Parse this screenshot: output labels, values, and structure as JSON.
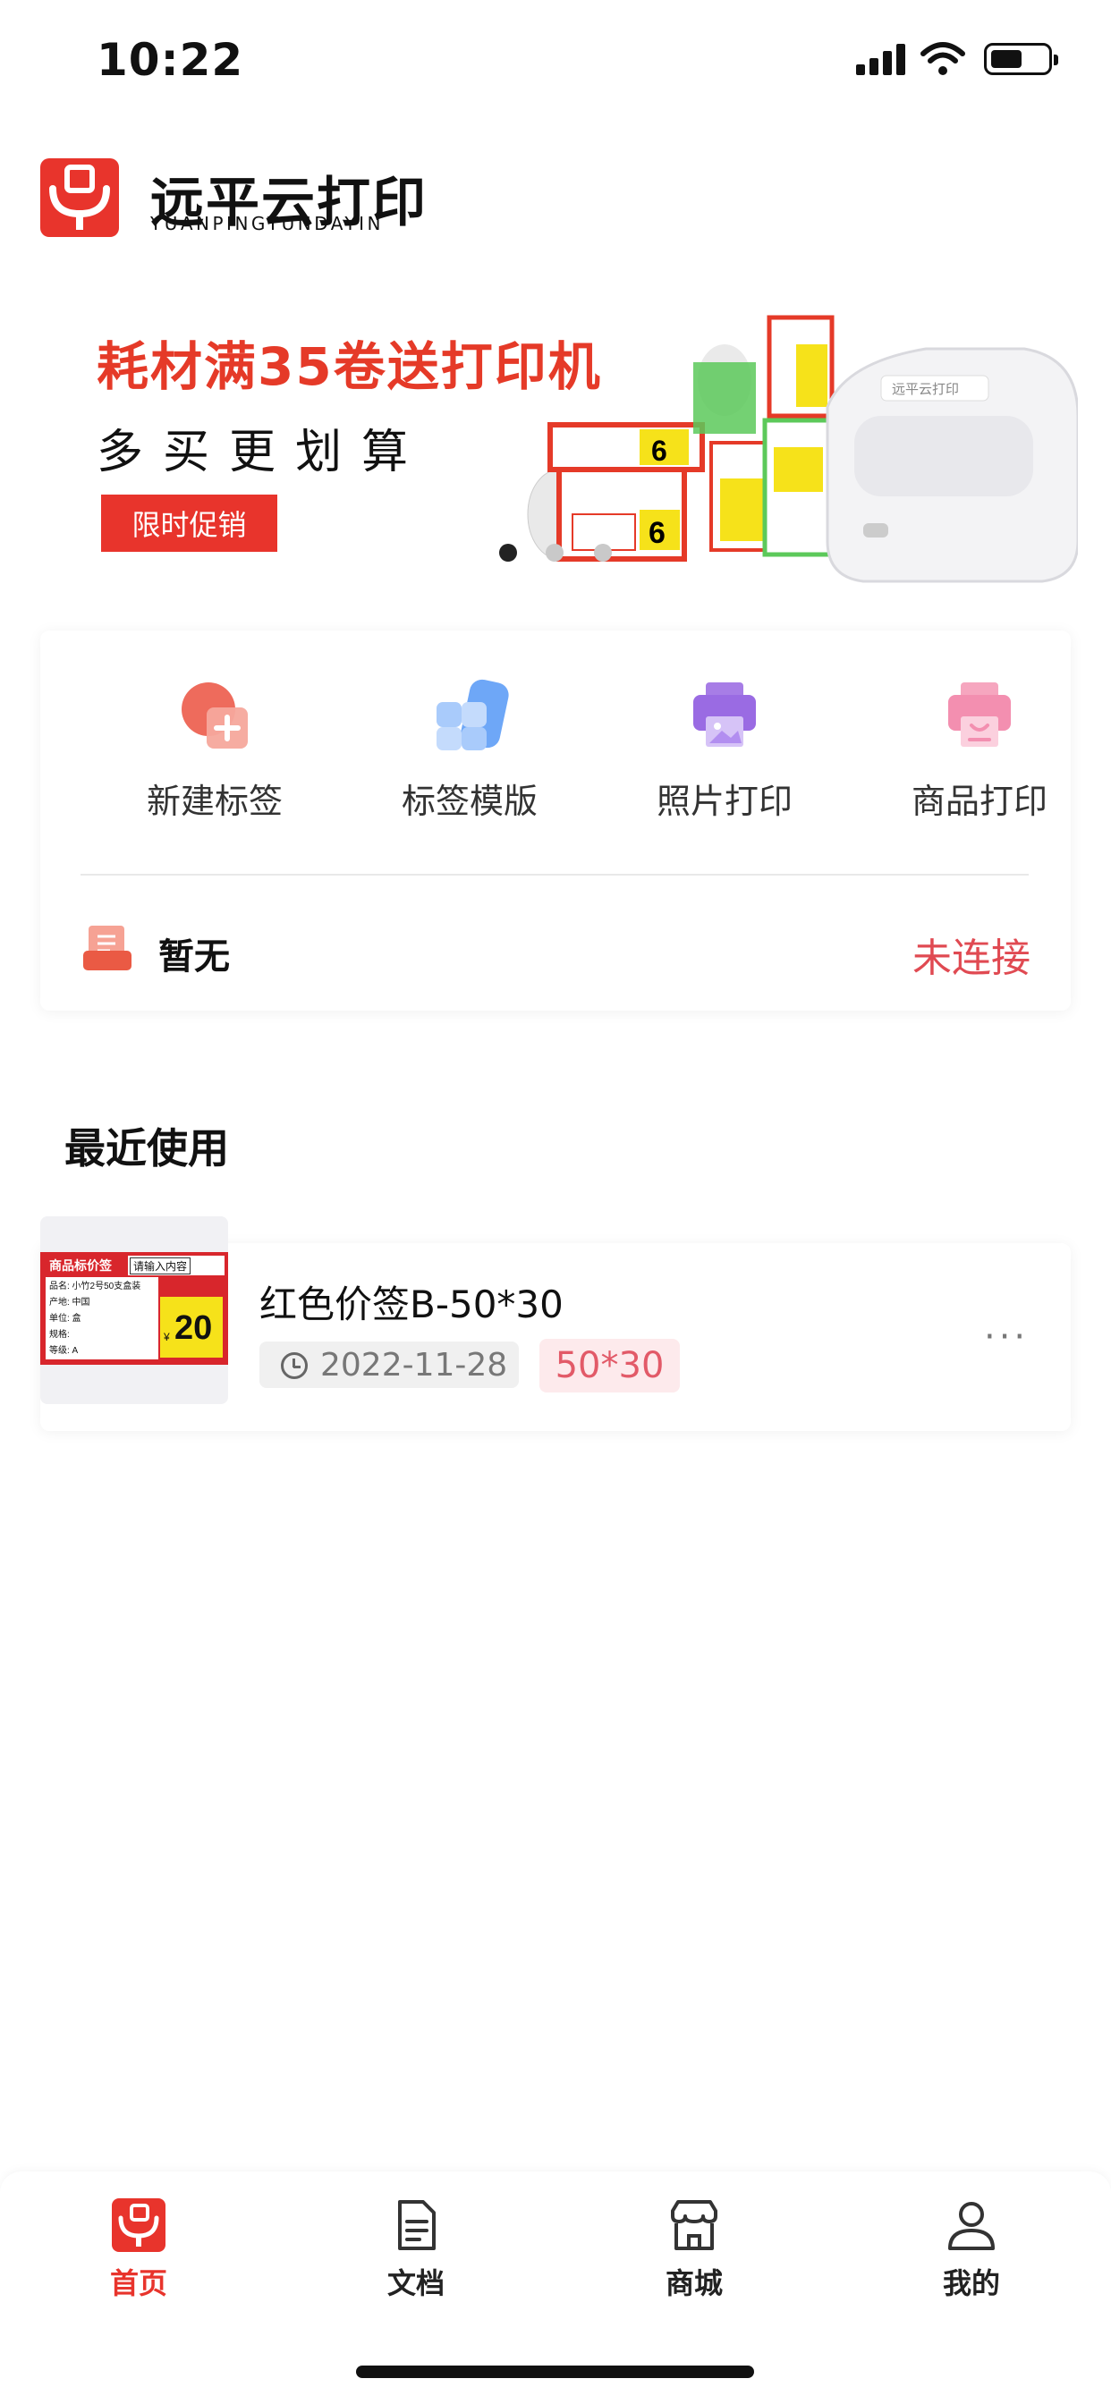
{
  "status_bar": {
    "time": "10:22"
  },
  "logo": {
    "name_cn": "远平云打印",
    "name_en": "YUANPINGYUNDAYIN"
  },
  "banner": {
    "title": "耗材满35卷送打印机",
    "subtitle": "多买更划算",
    "button_label": "限时促销",
    "printer_label_text": "远平云打印",
    "label_price_1": "6",
    "label_price_2": "6",
    "carousel": {
      "count": 3,
      "active_index": 0
    }
  },
  "quick_actions": [
    {
      "label": "新建标签",
      "icon": "new-label-icon"
    },
    {
      "label": "标签模版",
      "icon": "label-template-icon"
    },
    {
      "label": "照片打印",
      "icon": "photo-print-icon"
    },
    {
      "label": "商品打印",
      "icon": "product-print-icon"
    }
  ],
  "printer": {
    "name": "暂无",
    "status": "未连接",
    "icon": "printer-icon"
  },
  "recent": {
    "title": "最近使用",
    "items": [
      {
        "name": "红色价签B-50*30",
        "date": "2022-11-28",
        "size": "50*30",
        "thumbnail": {
          "header": "商品标价签",
          "input_hint": "请输入内容",
          "fields": [
            "品名: 小竹2号50支盒装",
            "产地: 中国",
            "单位: 盒",
            "规格:",
            "等级: A"
          ],
          "currency": "¥",
          "price": "20"
        }
      }
    ]
  },
  "more_label": "···",
  "tab_bar": [
    {
      "label": "首页",
      "icon": "home-icon",
      "active": true
    },
    {
      "label": "文档",
      "icon": "document-icon",
      "active": false
    },
    {
      "label": "商城",
      "icon": "store-icon",
      "active": false
    },
    {
      "label": "我的",
      "icon": "profile-icon",
      "active": false
    }
  ],
  "colors": {
    "brand_red": "#e8342c",
    "status_red": "#e04a52",
    "tab_active": "#e8342c"
  }
}
